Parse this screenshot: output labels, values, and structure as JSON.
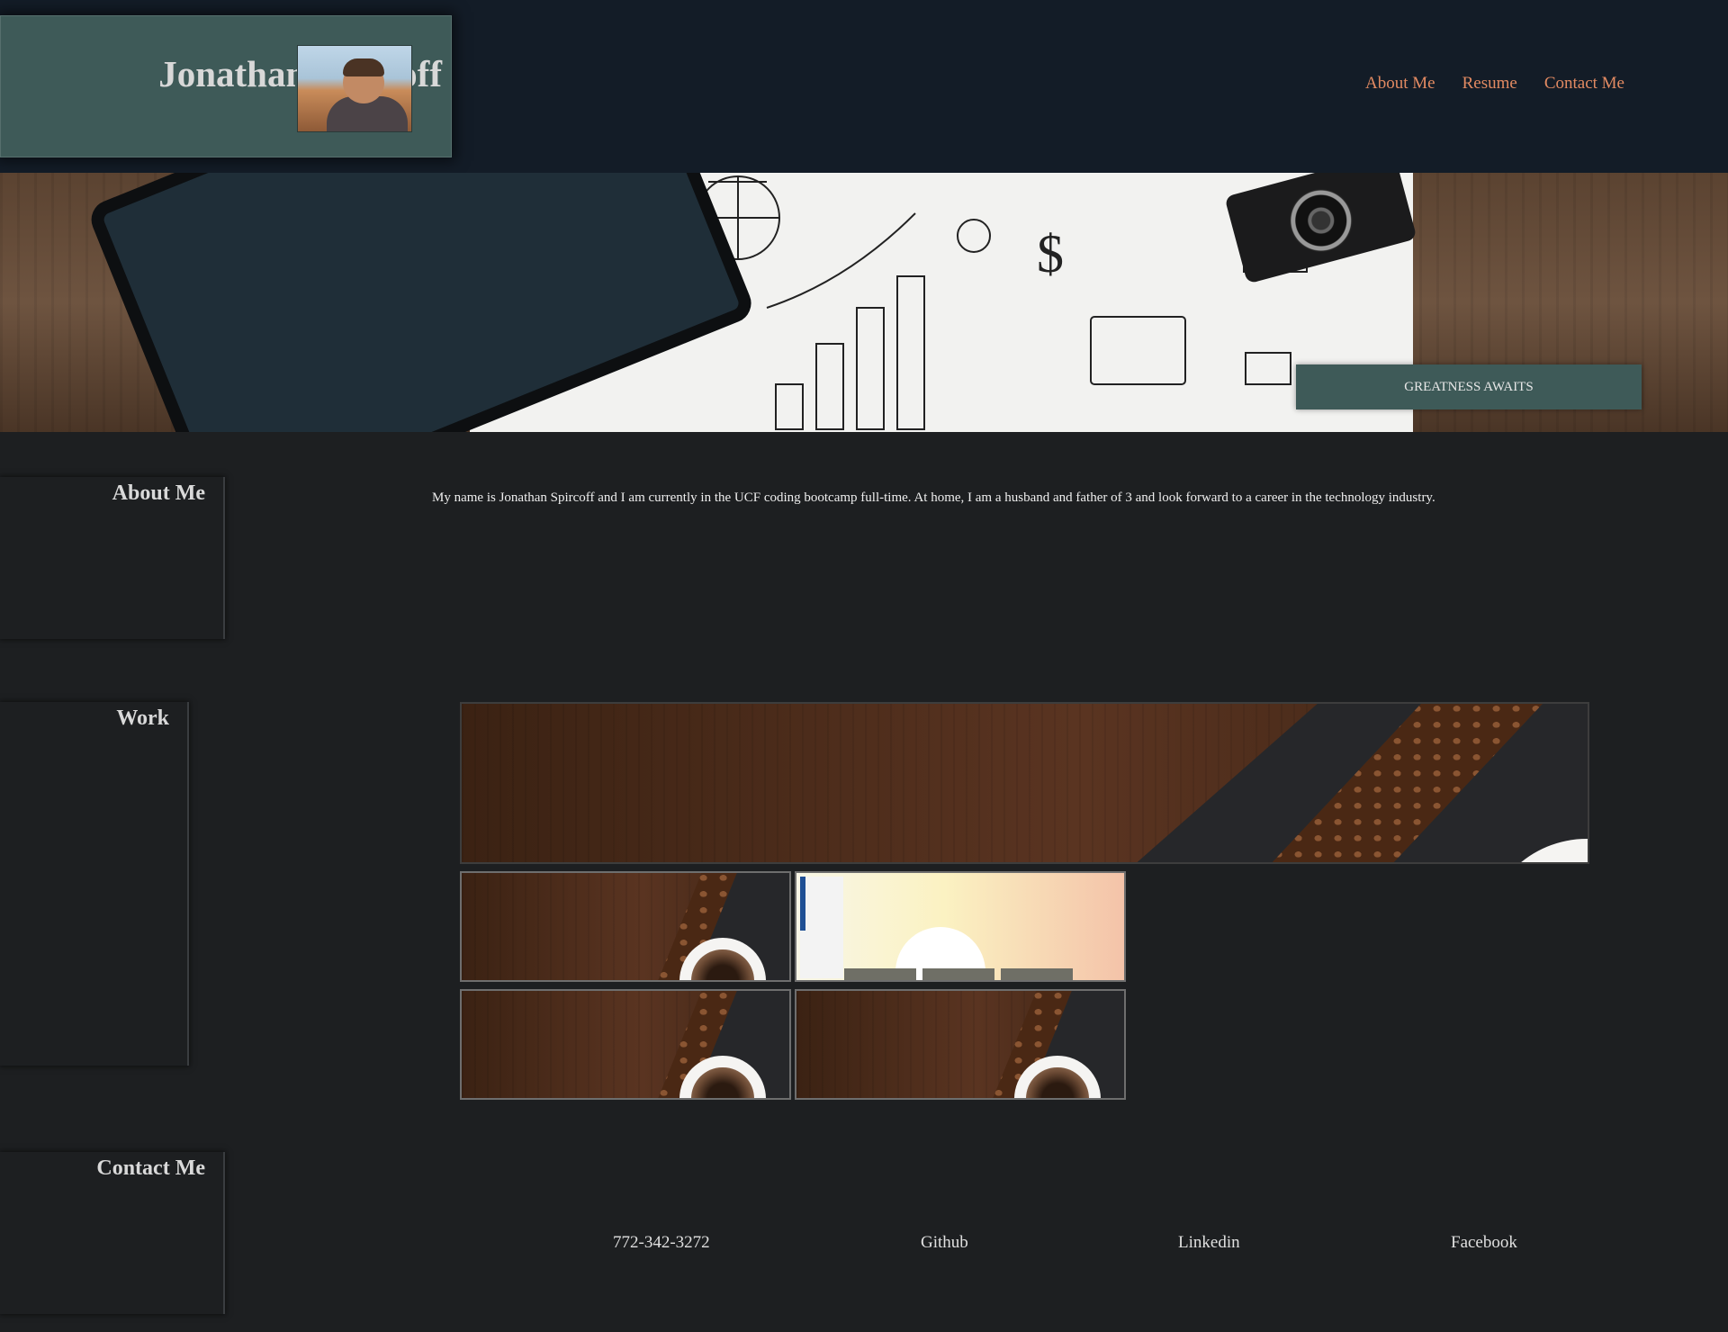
{
  "header": {
    "brand_name": "Jonathan Spircoff",
    "nav": [
      {
        "label": "About Me"
      },
      {
        "label": "Resume"
      },
      {
        "label": "Contact Me"
      }
    ]
  },
  "hero": {
    "button_label": "GREATNESS AWAITS"
  },
  "about": {
    "heading": "About Me",
    "text": "My name is Jonathan Spircoff and I am currently in the UCF coding bootcamp full-time. At home, I am a husband and father of 3 and look forward to a career in the technology industry."
  },
  "work": {
    "heading": "Work"
  },
  "contact": {
    "heading": "Contact Me",
    "links": [
      {
        "label": "772-342-3272"
      },
      {
        "label": "Github"
      },
      {
        "label": "Linkedin"
      },
      {
        "label": "Facebook"
      }
    ]
  },
  "colors": {
    "header_bg": "#131c27",
    "accent_teal": "#3e5a58",
    "nav_link": "#e28a62",
    "page_bg": "#1d1f21"
  }
}
